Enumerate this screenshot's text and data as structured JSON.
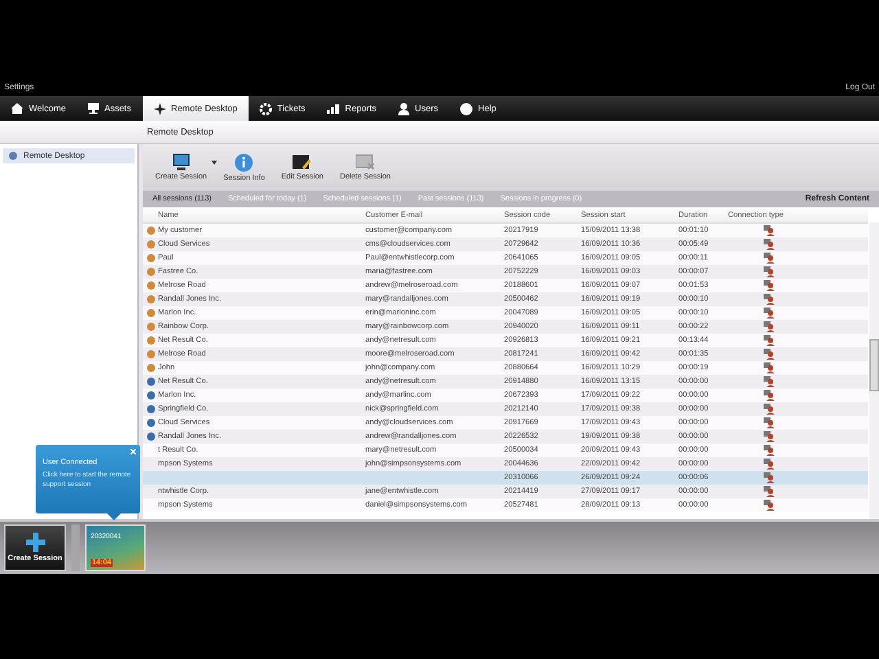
{
  "top_bar": {
    "settings": "Settings",
    "logout": "Log Out"
  },
  "tabs": [
    {
      "label": "Welcome",
      "selected": false
    },
    {
      "label": "Assets",
      "selected": false
    },
    {
      "label": "Remote Desktop",
      "selected": true
    },
    {
      "label": "Tickets",
      "selected": false
    },
    {
      "label": "Reports",
      "selected": false
    },
    {
      "label": "Users",
      "selected": false
    },
    {
      "label": "Help",
      "selected": false
    }
  ],
  "page_title": "Remote Desktop",
  "sidebar": {
    "items": [
      {
        "label": "Remote Desktop",
        "selected": true
      }
    ]
  },
  "toolbar": [
    {
      "label": "Create Session"
    },
    {
      "label": "Session Info"
    },
    {
      "label": "Edit Session"
    },
    {
      "label": "Delete Session"
    }
  ],
  "filters": [
    {
      "label": "All sessions (113)",
      "selected": true
    },
    {
      "label": "Scheduled for today (1)",
      "selected": false
    },
    {
      "label": "Scheduled sessions (1)",
      "selected": false
    },
    {
      "label": "Past sessions (113)",
      "selected": false
    },
    {
      "label": "Sessions in progress (0)",
      "selected": false
    }
  ],
  "refresh": "Refresh Content",
  "table": {
    "columns": [
      "Name",
      "Customer E-mail",
      "Session code",
      "Session start",
      "Duration",
      "Connection type"
    ],
    "rows": [
      {
        "kind": "past",
        "name": "My customer",
        "email": "customer@company.com",
        "code": "20217919",
        "start": "15/09/2011 13:38",
        "duration": "00:01:10",
        "selected": false
      },
      {
        "kind": "past",
        "name": "Cloud Services",
        "email": "cms@cloudservices.com",
        "code": "20729642",
        "start": "16/09/2011 10:36",
        "duration": "00:05:49",
        "selected": false
      },
      {
        "kind": "past",
        "name": "Paul",
        "email": "Paul@entwhistlecorp.com",
        "code": "20641065",
        "start": "16/09/2011 09:05",
        "duration": "00:00:11",
        "selected": false
      },
      {
        "kind": "past",
        "name": "Fastree Co.",
        "email": "maria@fastree.com",
        "code": "20752229",
        "start": "16/09/2011 09:03",
        "duration": "00:00:07",
        "selected": false
      },
      {
        "kind": "past",
        "name": "Melrose Road",
        "email": "andrew@melroseroad.com",
        "code": "20188601",
        "start": "16/09/2011 09:07",
        "duration": "00:01:53",
        "selected": false
      },
      {
        "kind": "past",
        "name": "Randall Jones Inc.",
        "email": "mary@randalljones.com",
        "code": "20500462",
        "start": "16/09/2011 09:19",
        "duration": "00:00:10",
        "selected": false
      },
      {
        "kind": "past",
        "name": "Marlon Inc.",
        "email": "erin@marloninc.com",
        "code": "20047089",
        "start": "16/09/2011 09:05",
        "duration": "00:00:10",
        "selected": false
      },
      {
        "kind": "past",
        "name": "Rainbow Corp.",
        "email": "mary@rainbowcorp.com",
        "code": "20940020",
        "start": "16/09/2011 09:11",
        "duration": "00:00:22",
        "selected": false
      },
      {
        "kind": "past",
        "name": "Net Result Co.",
        "email": "andy@netresult.com",
        "code": "20926813",
        "start": "16/09/2011 09:21",
        "duration": "00:13:44",
        "selected": false
      },
      {
        "kind": "past",
        "name": "Melrose Road",
        "email": "moore@melroseroad.com",
        "code": "20817241",
        "start": "16/09/2011 09:42",
        "duration": "00:01:35",
        "selected": false
      },
      {
        "kind": "past",
        "name": "John",
        "email": "john@company.com",
        "code": "20880664",
        "start": "16/09/2011 10:29",
        "duration": "00:00:19",
        "selected": false
      },
      {
        "kind": "scheduled",
        "name": "Net Result Co.",
        "email": "andy@netresult.com",
        "code": "20914880",
        "start": "16/09/2011 13:15",
        "duration": "00:00:00",
        "selected": false
      },
      {
        "kind": "scheduled",
        "name": "Marlon Inc.",
        "email": "andy@marlinc.com",
        "code": "20672393",
        "start": "17/09/2011 09:22",
        "duration": "00:00:00",
        "selected": false
      },
      {
        "kind": "scheduled",
        "name": "Springfield Co.",
        "email": "nick@springfield.com",
        "code": "20212140",
        "start": "17/09/2011 09:38",
        "duration": "00:00:00",
        "selected": false
      },
      {
        "kind": "scheduled",
        "name": "Cloud Services",
        "email": "andy@cloudservices.com",
        "code": "20917669",
        "start": "17/09/2011 09:43",
        "duration": "00:00:00",
        "selected": false
      },
      {
        "kind": "scheduled",
        "name": "Randall Jones Inc.",
        "email": "andrew@randalljones.com",
        "code": "20226532",
        "start": "19/09/2011 09:38",
        "duration": "00:00:00",
        "selected": false
      },
      {
        "kind": "hidden",
        "name": "t Result Co.",
        "email": "mary@netresult.com",
        "code": "20500034",
        "start": "20/09/2011 09:43",
        "duration": "00:00:00",
        "selected": false
      },
      {
        "kind": "hidden",
        "name": "mpson Systems",
        "email": "john@simpsonsystems.com",
        "code": "20044636",
        "start": "22/09/2011 09:42",
        "duration": "00:00:00",
        "selected": false
      },
      {
        "kind": "hidden",
        "code": "20310066",
        "start": "26/09/2011 09:24",
        "duration": "00:00:06",
        "selected": true
      },
      {
        "kind": "hidden",
        "name": "ntwhistle Corp.",
        "email": "jane@entwhistle.com",
        "code": "20214419",
        "start": "27/09/2011 09:17",
        "duration": "00:00:00",
        "selected": false
      },
      {
        "kind": "hidden",
        "name": "mpson Systems",
        "email": "daniel@simpsonsystems.com",
        "code": "20527481",
        "start": "28/09/2011 09:13",
        "duration": "00:00:00",
        "selected": false
      }
    ]
  },
  "tooltip": {
    "title": "User Connected",
    "text": "Click here to start the remote support session"
  },
  "dock": {
    "create": "Create Session",
    "session_code": "20320041",
    "session_time": "14:04"
  }
}
